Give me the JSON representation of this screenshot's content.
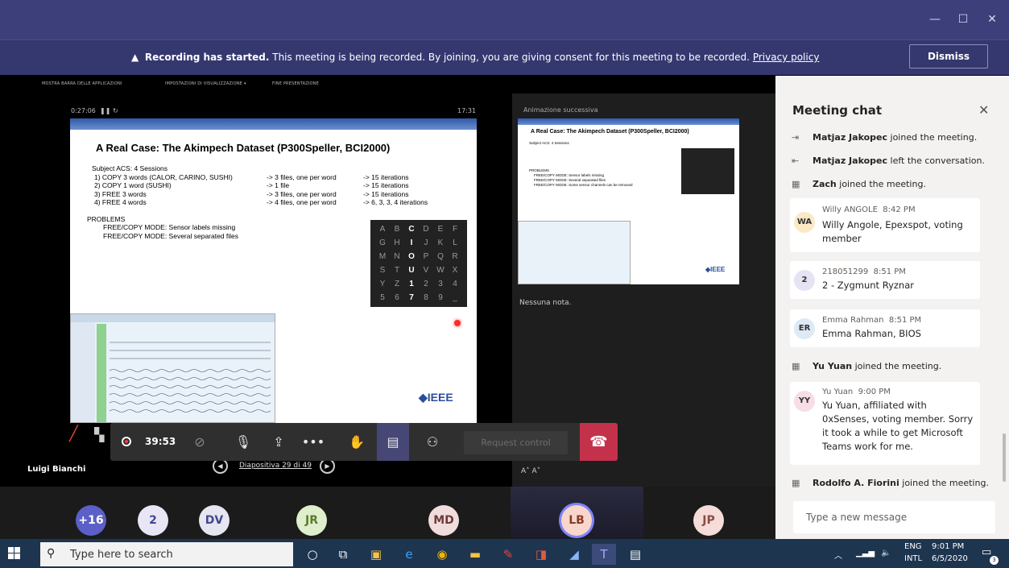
{
  "banner": {
    "title": "Recording has started.",
    "text": "This meeting is being recorded. By joining, you are giving consent for this meeting to be recorded.",
    "link": "Privacy policy",
    "dismiss": "Dismiss"
  },
  "ppt": {
    "toolbar": [
      "MOSTRA BARRA DELLE APPLICAZIONI",
      "IMPOSTAZIONI DI VISUALIZZAZIONE ▾",
      "FINE PRESENTAZIONE"
    ],
    "elapsed": "0:27:06",
    "clock": "17:31",
    "next_label": "Animazione successiva",
    "notes": "Nessuna nota.",
    "slide_counter": "Diapositiva 29 di 49"
  },
  "slide": {
    "title": "A Real Case: The Akimpech Dataset  (P300Speller, BCI2000)",
    "subject": "Subject ACS: 4 Sessions",
    "sessions": [
      {
        "item": "1)  COPY 3 words (CALOR, CARINO, SUSHI)",
        "files": "-> 3 files, one per word",
        "iter": "->  15 iterations"
      },
      {
        "item": "2)  COPY 1 word (SUSHI)",
        "files": "-> 1 file",
        "iter": "->  15 iterations"
      },
      {
        "item": "3)  FREE 3 words",
        "files": "-> 3 files, one per word",
        "iter": "->  15 iterations"
      },
      {
        "item": "4)  FREE 4 words",
        "files": "-> 4 files, one per word",
        "iter": "->  6, 3, 3, 4 iterations"
      }
    ],
    "problems_title": "PROBLEMS",
    "problems": [
      "FREE/COPY MODE: Sensor labels missing",
      "FREE/COPY MODE: Several separated files"
    ],
    "speller": [
      [
        "A",
        "B",
        "C",
        "D",
        "E",
        "F"
      ],
      [
        "G",
        "H",
        "I",
        "J",
        "K",
        "L"
      ],
      [
        "M",
        "N",
        "O",
        "P",
        "Q",
        "R"
      ],
      [
        "S",
        "T",
        "U",
        "V",
        "W",
        "X"
      ],
      [
        "Y",
        "Z",
        "1",
        "2",
        "3",
        "4"
      ],
      [
        "5",
        "6",
        "7",
        "8",
        "9",
        "_"
      ]
    ],
    "logo": "◆IEEE"
  },
  "next_slide": {
    "title": "A Real Case: The Akimpech Dataset  (P300Speller, BCI2000)",
    "subject": "Subject ACS: 4 Sessions",
    "problems": [
      "PROBLEMS",
      "FREE/COPY MODE: Sensor labels missing",
      "FREE/COPY MODE: Several separated files",
      "FREE/COPY MODE: Some sensor channels can be removed"
    ],
    "logo": "◆IEEE"
  },
  "presenter": "Luigi Bianchi",
  "callbar": {
    "duration": "39:53",
    "request_control": "Request control"
  },
  "participants": [
    {
      "label": "+16",
      "bg": "#5b5fc7",
      "fg": "#ffffff"
    },
    {
      "label": "2",
      "bg": "#e8e6f5",
      "fg": "#444791"
    },
    {
      "label": "DV",
      "bg": "#e6e6f0",
      "fg": "#444791"
    },
    {
      "label": "JR",
      "bg": "#dfeecd",
      "fg": "#5a7a2c"
    },
    {
      "label": "MD",
      "bg": "#f1dcdc",
      "fg": "#6e3a3a"
    },
    {
      "label": "LB",
      "bg": "#f8d6cc",
      "fg": "#8b3a2a"
    },
    {
      "label": "JP",
      "bg": "#f6dcd8",
      "fg": "#8a4d44"
    }
  ],
  "chat": {
    "title": "Meeting chat",
    "input_placeholder": "Type a new message",
    "events": [
      {
        "name": "Matjaz Jakopec",
        "text": " joined the meeting."
      },
      {
        "name": "Matjaz Jakopec",
        "text": " left the conversation."
      },
      {
        "name": "Zach",
        "text": " joined the meeting."
      },
      {
        "name": "Yu Yuan",
        "text": " joined the meeting."
      },
      {
        "name": "Rodolfo A. Fiorini",
        "text": " joined the meeting."
      }
    ],
    "messages": [
      {
        "initials": "WA",
        "author": "Willy ANGOLE",
        "time": "8:42 PM",
        "text": "Willy Angole, Epexspot, voting member",
        "color": "#fbe9c6"
      },
      {
        "initials": "2",
        "author": "218051299",
        "time": "8:51 PM",
        "text": "2 - Zygmunt Ryznar",
        "color": "#e6e4f3"
      },
      {
        "initials": "ER",
        "author": "Emma Rahman",
        "time": "8:51 PM",
        "text": "Emma Rahman, BIOS",
        "color": "#dde9f5"
      },
      {
        "initials": "YY",
        "author": "Yu Yuan",
        "time": "9:00 PM",
        "text": "Yu Yuan, affiliated with 0xSenses, voting member. Sorry it took a while to get Microsoft Teams work for me.",
        "color": "#f6dde6"
      }
    ]
  },
  "taskbar": {
    "search_placeholder": "Type here to search",
    "lang": "ENG",
    "region": "INTL",
    "time": "9:01 PM",
    "date": "6/5/2020",
    "badge": "3"
  }
}
